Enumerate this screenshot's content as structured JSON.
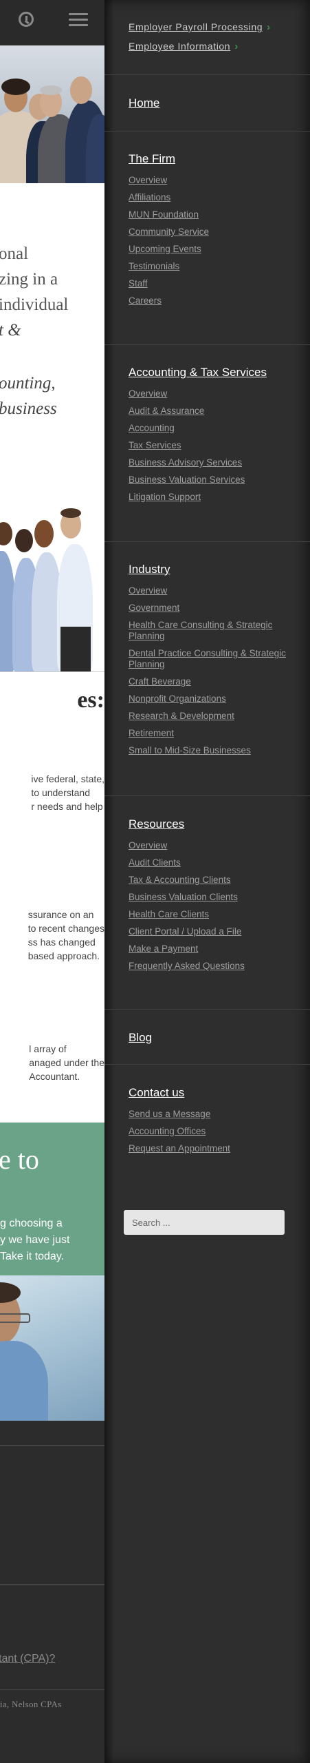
{
  "left_page": {
    "intro_lines": [
      "onal",
      "zing in a",
      "individual",
      "t &",
      "ounting,",
      "business"
    ],
    "services_heading": "es:",
    "service_paragraphs": [
      [
        "ive federal, state,",
        "to understand",
        "r needs and help"
      ],
      [
        "ssurance on an",
        " to recent changes",
        "ss has changed",
        "based approach."
      ],
      [
        "l array of",
        "anaged under the",
        "Accountant."
      ]
    ],
    "green_heading": "e to",
    "green_text": [
      "g choosing a",
      "y we have just",
      "Take it today."
    ],
    "bottom_link": "tant (CPA)?",
    "bottom_copy": "tia, Nelson CPAs"
  },
  "menu": {
    "top_links": [
      "Employer Payroll Processing",
      "Employee Information"
    ],
    "home": "Home",
    "the_firm": {
      "title": "The Firm",
      "items": [
        "Overview",
        "Affiliations",
        "MUN Foundation",
        "Community Service",
        "Upcoming Events",
        "Testimonials",
        "Staff",
        "Careers"
      ]
    },
    "accounting": {
      "title": "Accounting & Tax Services",
      "items": [
        "Overview",
        "Audit & Assurance",
        "Accounting",
        "Tax Services",
        "Business Advisory Services",
        "Business Valuation Services",
        "Litigation Support"
      ]
    },
    "industry": {
      "title": "Industry",
      "items": [
        "Overview",
        "Government",
        "Health Care Consulting & Strategic Planning",
        "Dental Practice Consulting & Strategic Planning",
        "Craft Beverage",
        "Nonprofit Organizations",
        "Research & Development",
        "Retirement",
        "Small to Mid-Size Businesses"
      ]
    },
    "resources": {
      "title": "Resources",
      "items": [
        "Overview",
        "Audit Clients",
        "Tax & Accounting Clients",
        "Business Valuation Clients",
        "Health Care Clients",
        "Client Portal / Upload a File",
        "Make a Payment",
        "Frequently Asked Questions"
      ]
    },
    "blog": "Blog",
    "contact": {
      "title": "Contact us",
      "items": [
        "Send us a Message",
        "Accounting Offices",
        "Request an Appointment"
      ]
    },
    "search_placeholder": "Search ..."
  },
  "colors": {
    "menu_bg": "#2e2e2e",
    "accent_green": "#3c8f4a",
    "banner_green": "#6ba388"
  }
}
